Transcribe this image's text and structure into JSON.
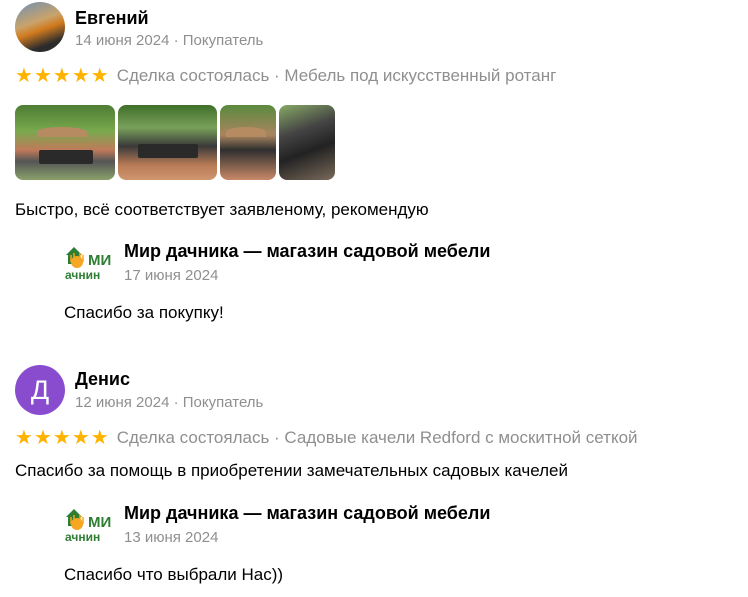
{
  "reviews": [
    {
      "author": "Евгений",
      "date": "14 июня 2024",
      "role": "Покупатель",
      "meta": "14 июня 2024 · Покупатель",
      "stars": 5,
      "deal": "Сделка состоялась · Мебель под искусственный ротанг",
      "photos": [
        "patio-photo-1",
        "patio-photo-2",
        "patio-photo-3",
        "patio-photo-4"
      ],
      "text": "Быстро, всё соответствует заявленому, рекомендую",
      "reply": {
        "shop": "Мир дачника — магазин садовой мебели",
        "logo_text_top": "МИ",
        "logo_text_bottom": "ачнин",
        "date": "17 июня 2024",
        "text": "Спасибо за покупку!"
      }
    },
    {
      "author": "Денис",
      "avatar_letter": "Д",
      "date": "12 июня 2024",
      "role": "Покупатель",
      "meta": "12 июня 2024 · Покупатель",
      "stars": 5,
      "deal": "Сделка состоялась · Садовые качели Redford с москитной сеткой",
      "text": "Спасибо за помощь в приобретении замечательных садовых качелей",
      "reply": {
        "shop": "Мир дачника — магазин садовой мебели",
        "logo_text_top": "МИ",
        "logo_text_bottom": "ачнин",
        "date": "13 июня 2024",
        "text": "Спасибо что выбрали Нас))"
      }
    }
  ],
  "colors": {
    "star": "#ffb300",
    "muted": "#8f8f8f",
    "avatar_purple": "#8a4ccf",
    "logo_green": "#2e7d32",
    "logo_orange": "#f5a623"
  }
}
